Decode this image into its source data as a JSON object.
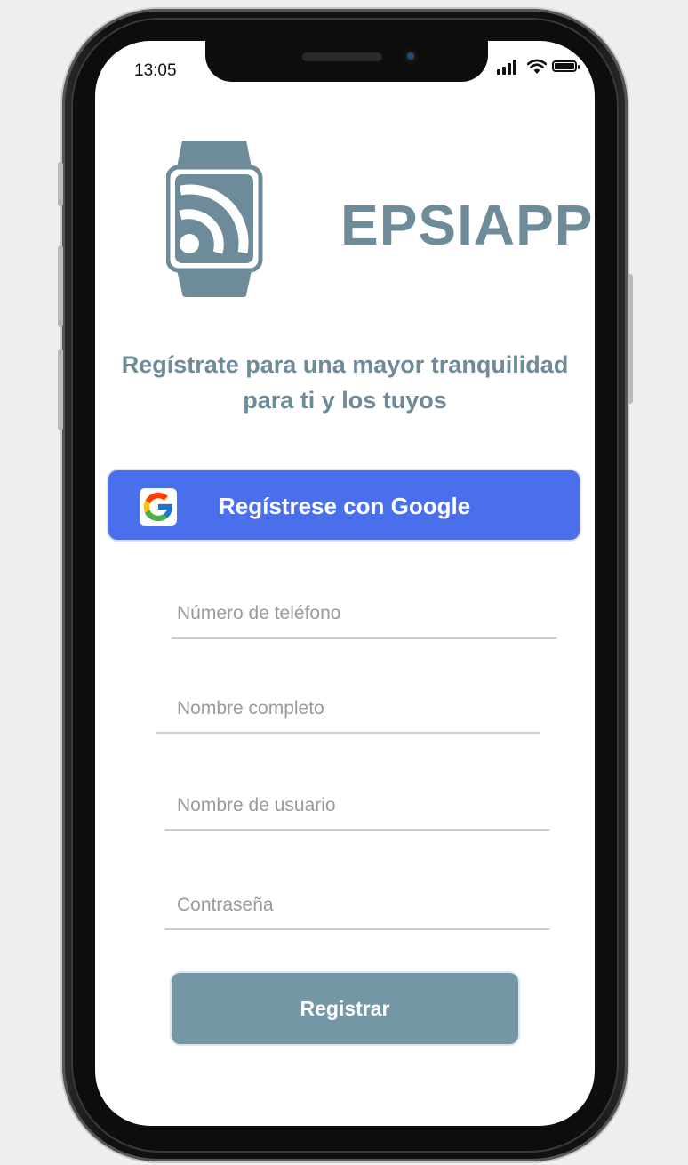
{
  "status_bar": {
    "time": "13:05"
  },
  "brand": {
    "name": "EPSIAPP",
    "logo_icon": "smartwatch-rss-icon",
    "color": "#6d8b99"
  },
  "headline": {
    "line1": "Regístrate para una mayor tranquilidad",
    "line2": "para ti y los tuyos"
  },
  "google_button": {
    "label": "Regístrese con Google",
    "icon": "google-icon",
    "color": "#4a6fec"
  },
  "form": {
    "phone_placeholder": "Número de teléfono",
    "fullname_placeholder": "Nombre completo",
    "username_placeholder": "Nombre de usuario",
    "password_placeholder": "Contraseña"
  },
  "register_button": {
    "label": "Registrar",
    "color": "#7497a6"
  }
}
